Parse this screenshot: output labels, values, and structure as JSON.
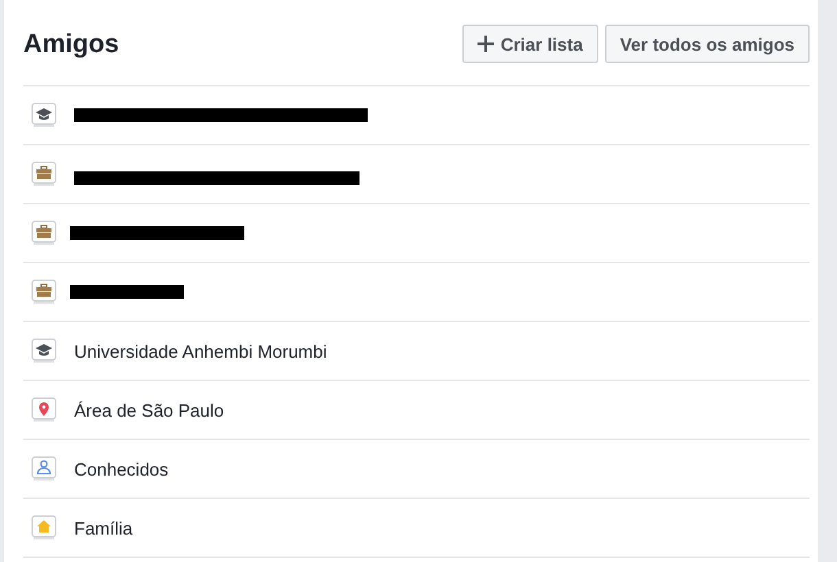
{
  "header": {
    "title": "Amigos",
    "buttons": [
      {
        "kind": "create",
        "label": "Criar lista"
      },
      {
        "kind": "plain",
        "label": "Ver todos os amigos"
      }
    ]
  },
  "lists": [
    {
      "kind": "school",
      "redacted": true
    },
    {
      "kind": "work",
      "redacted": true
    },
    {
      "kind": "work",
      "redacted": true
    },
    {
      "kind": "work",
      "redacted": true
    },
    {
      "kind": "school",
      "label": "Universidade Anhembi Morumbi"
    },
    {
      "kind": "place",
      "label": "Área de São Paulo"
    },
    {
      "kind": "acquaintances",
      "label": "Conhecidos"
    },
    {
      "kind": "family",
      "label": "Família"
    }
  ]
}
